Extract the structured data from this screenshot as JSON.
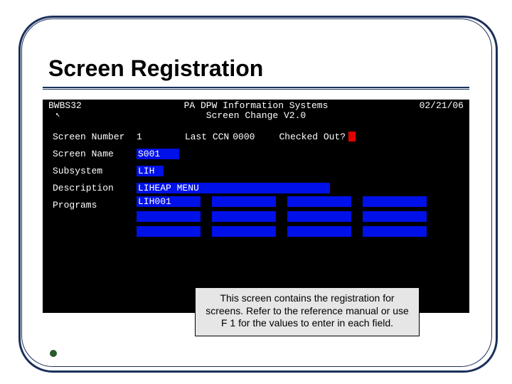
{
  "slide": {
    "title": "Screen Registration",
    "callout": "This screen contains the registration for screens.  Refer to the reference manual or use F 1 for the values to enter in each field."
  },
  "terminal": {
    "header": {
      "session": "BWBS32",
      "title": "PA DPW Information Systems",
      "subtitle": "Screen Change V2.0",
      "date": "02/21/06"
    },
    "labels": {
      "screen_number": "Screen Number",
      "last_ccn": "Last CCN",
      "checked_out": "Checked Out?",
      "screen_name": "Screen Name",
      "subsystem": "Subsystem",
      "description": "Description",
      "programs": "Programs"
    },
    "values": {
      "screen_number": "1",
      "last_ccn": "0000",
      "checked_out": "",
      "screen_name": "S001",
      "subsystem": "LIH",
      "description": "LIHEAP MENU",
      "programs": [
        "LIH001",
        "",
        "",
        "",
        "",
        "",
        "",
        "",
        "",
        "",
        "",
        ""
      ]
    },
    "field_widths": {
      "screen_name": "56px",
      "subsystem": "34px",
      "description": "268px",
      "program": "86px"
    }
  }
}
